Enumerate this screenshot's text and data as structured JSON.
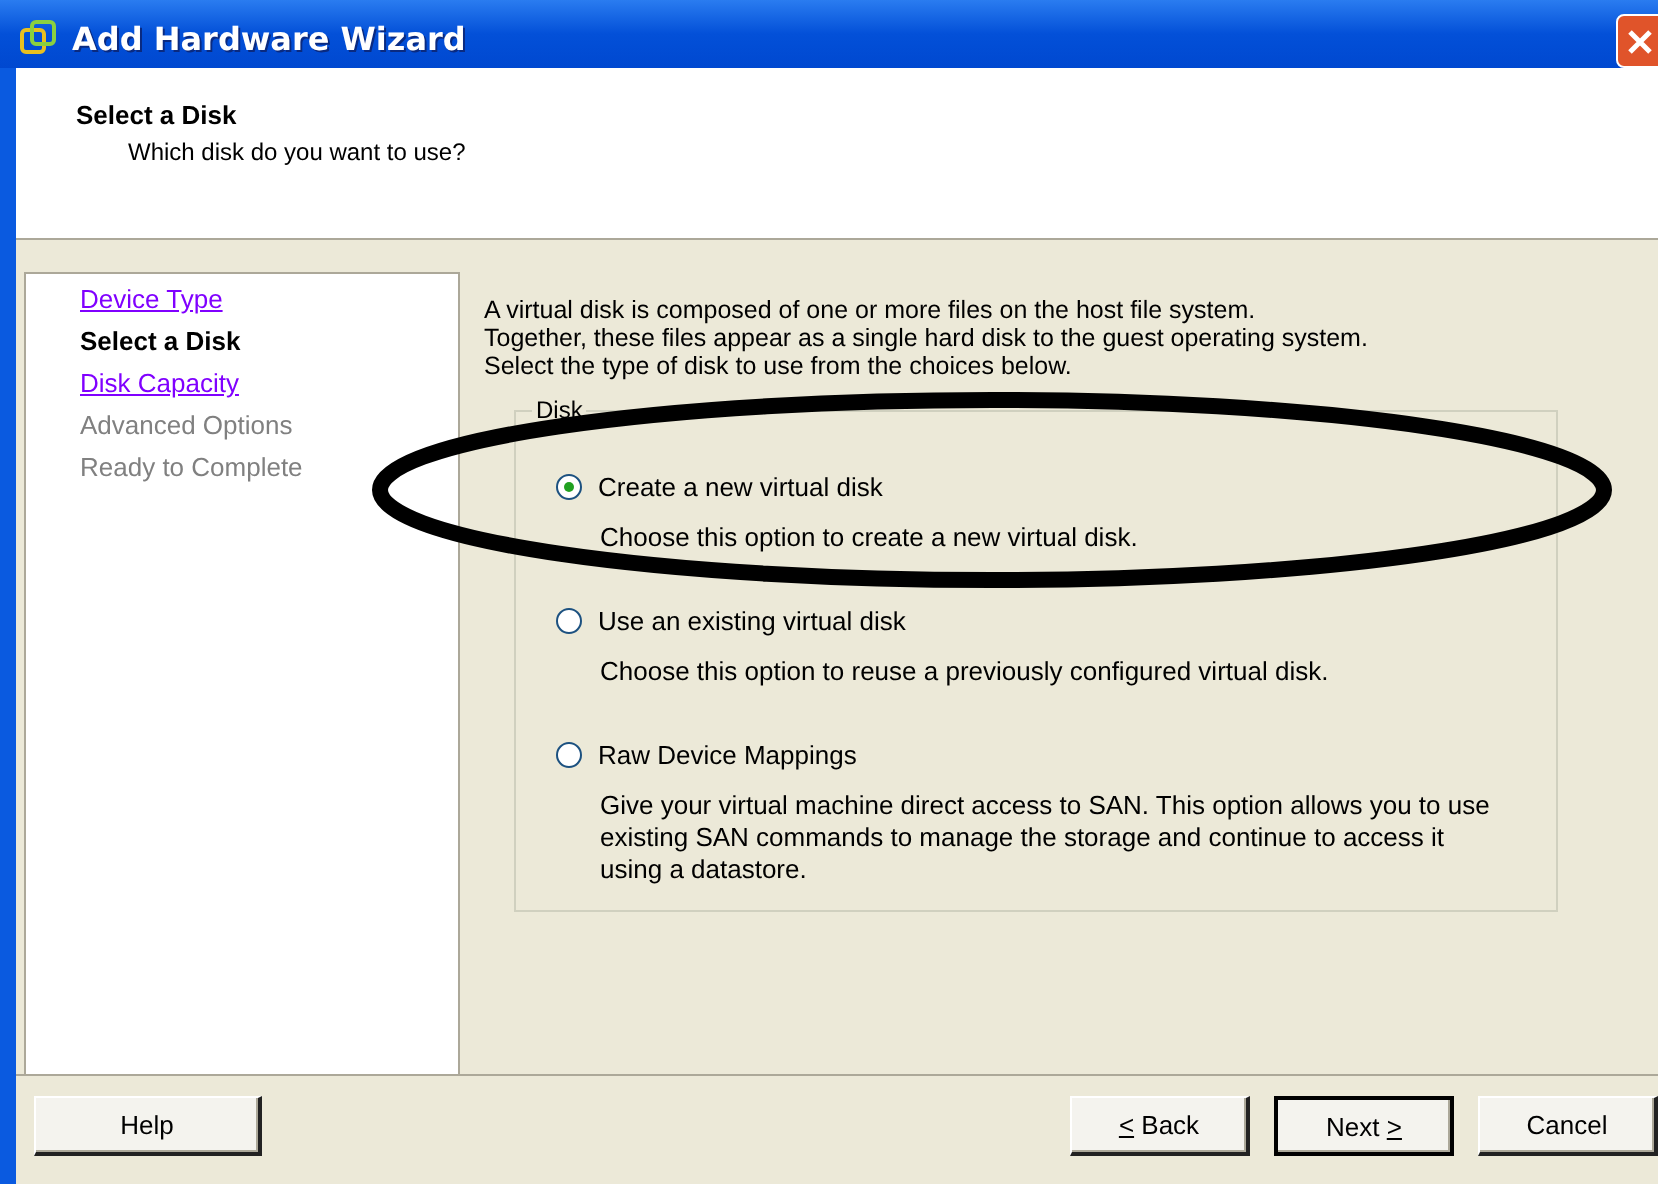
{
  "window": {
    "title": "Add Hardware Wizard"
  },
  "header": {
    "title": "Select a Disk",
    "subtitle": "Which disk do you want to use?"
  },
  "steps": [
    {
      "label": "Device Type",
      "selected": false,
      "disabled": false
    },
    {
      "label": "Select a Disk",
      "selected": true,
      "disabled": false
    },
    {
      "label": "Disk Capacity",
      "selected": false,
      "disabled": false
    },
    {
      "label": "Advanced Options",
      "selected": false,
      "disabled": true
    },
    {
      "label": "Ready to Complete",
      "selected": false,
      "disabled": true
    }
  ],
  "intro": [
    "A virtual disk is composed of one or more files on the host file system.",
    "Together, these files appear as a single hard disk to the guest operating system.",
    "Select the type of disk to use from the choices below."
  ],
  "group": {
    "legend": "Disk",
    "options": [
      {
        "label": "Create a new virtual disk",
        "description": "Choose this option to create a new virtual disk.",
        "selected": true
      },
      {
        "label": "Use an existing virtual disk",
        "description": "Choose this option to reuse a previously configured virtual disk.",
        "selected": false
      },
      {
        "label": "Raw Device Mappings",
        "description": "Give your virtual machine direct access to SAN. This option allows you to use existing SAN commands to manage the storage and continue to access it using a datastore.",
        "selected": false
      }
    ]
  },
  "annotation": {
    "kind": "ellipse"
  },
  "buttons": [
    {
      "label": "Help",
      "kind": "left",
      "default": false
    },
    {
      "label": "Back",
      "kind": "right",
      "default": false,
      "mnemonic": "<",
      "mnemonic_first": true
    },
    {
      "label": "Next",
      "kind": "right",
      "default": true,
      "mnemonic": ">",
      "mnemonic_first": false
    },
    {
      "label": "Cancel",
      "kind": "right",
      "default": false
    }
  ]
}
